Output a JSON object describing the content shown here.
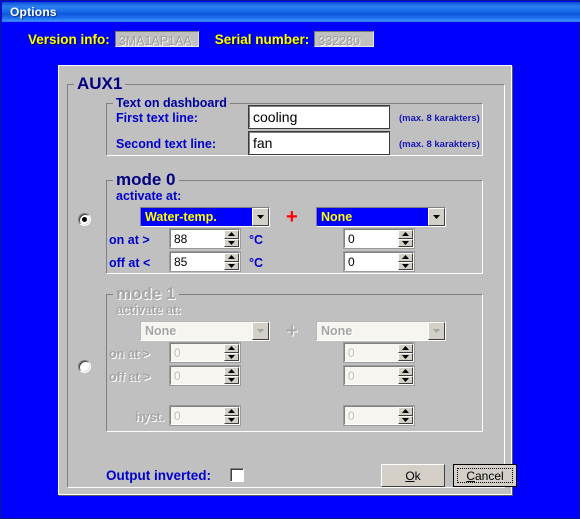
{
  "window": {
    "title": "Options"
  },
  "info": {
    "version_label": "Version info:",
    "version_value": "3MA1AP1AA",
    "serial_label": "Serial number:",
    "serial_value": "332280"
  },
  "panel": {
    "legend": "AUX1",
    "dashboard": {
      "legend": "Text on dashboard",
      "first_label": "First text line:",
      "first_value": "cooling",
      "first_hint": "(max. 8 karakters)",
      "second_label": "Second text line:",
      "second_value": "fan",
      "second_hint": "(max. 8 karakters)"
    },
    "mode0": {
      "legend": "mode 0",
      "activate_label": "activate at:",
      "selected": true,
      "source_a": "Water-temp.",
      "operator": "+",
      "source_b": "None",
      "on_label": "on at >",
      "on_value_a": "88",
      "on_unit_a": "°C",
      "on_value_b": "0",
      "off_label": "off at <",
      "off_value_a": "85",
      "off_unit_a": "°C",
      "off_value_b": "0"
    },
    "mode1": {
      "legend": "mode 1",
      "activate_label": "activate at:",
      "selected": false,
      "source_a": "None",
      "operator": "+",
      "source_b": "None",
      "on_label": "on at >",
      "on_value_a": "0",
      "on_value_b": "0",
      "off_label": "off at >",
      "off_value_a": "0",
      "off_value_b": "0",
      "hyst_label": "hyst.",
      "hyst_value_a": "0",
      "hyst_value_b": "0"
    },
    "footer": {
      "output_inverted_label": "Output inverted:",
      "output_inverted_checked": false,
      "ok_label": "Ok",
      "ok_accel": "O",
      "ok_rest": "k",
      "cancel_label": "Cancel",
      "cancel_accel": "C",
      "cancel_rest": "ancel"
    }
  },
  "colors": {
    "title_blue": "#1569e6",
    "background_blue": "#0000ff",
    "label_yellow": "#ffff00",
    "label_blue": "#0000cc",
    "panel_gray": "#c0c0c0",
    "plus_red": "#ff0000",
    "disabled_gray": "#a5a5a5"
  }
}
